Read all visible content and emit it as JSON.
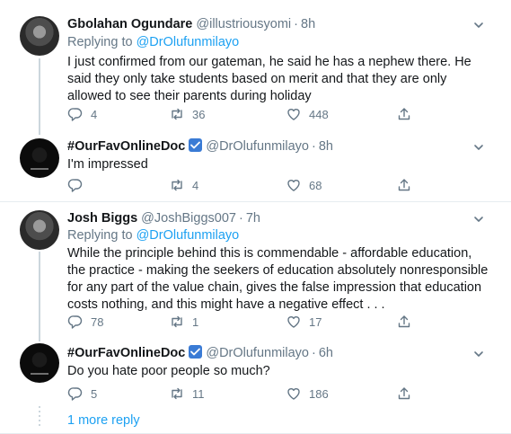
{
  "tweets": [
    {
      "name": "Gbolahan Ogundare",
      "handle": "@illustriousyomi",
      "time": "8h",
      "replying_prefix": "Replying to",
      "replying_to": "@DrOlufunmilayo",
      "text": "I just confirmed from our gateman, he said he has a nephew there. He said they only take students based on merit and that they are only allowed to see their parents during holiday",
      "replies": "4",
      "retweets": "36",
      "likes": "448"
    },
    {
      "name": "#OurFavOnlineDoc",
      "handle": "@DrOlufunmilayo",
      "time": "8h",
      "text": "I'm impressed",
      "replies": "",
      "retweets": "4",
      "likes": "68"
    },
    {
      "name": "Josh Biggs",
      "handle": "@JoshBiggs007",
      "time": "7h",
      "replying_prefix": "Replying to",
      "replying_to": "@DrOlufunmilayo",
      "text": "While the principle behind this is commendable - affordable education, the practice - making the seekers of education absolutely nonresponsible for any part of the value chain, gives the false impression that education costs nothing, and this might have a negative effect . . .",
      "replies": "78",
      "retweets": "1",
      "likes": "17"
    },
    {
      "name": "#OurFavOnlineDoc",
      "handle": "@DrOlufunmilayo",
      "time": "6h",
      "text": "Do you hate poor people so much?",
      "replies": "5",
      "retweets": "11",
      "likes": "186"
    }
  ],
  "more_replies": "1 more reply",
  "colors": {
    "text": "#14171a",
    "muted": "#657786",
    "link": "#1da1f2",
    "divider": "#e6ecf0",
    "thread": "#ccd6dd",
    "verified": "#3a7bd5"
  },
  "icons": [
    "reply-icon",
    "retweet-icon",
    "like-icon",
    "share-icon",
    "caret-down-icon",
    "verified-badge-icon"
  ]
}
